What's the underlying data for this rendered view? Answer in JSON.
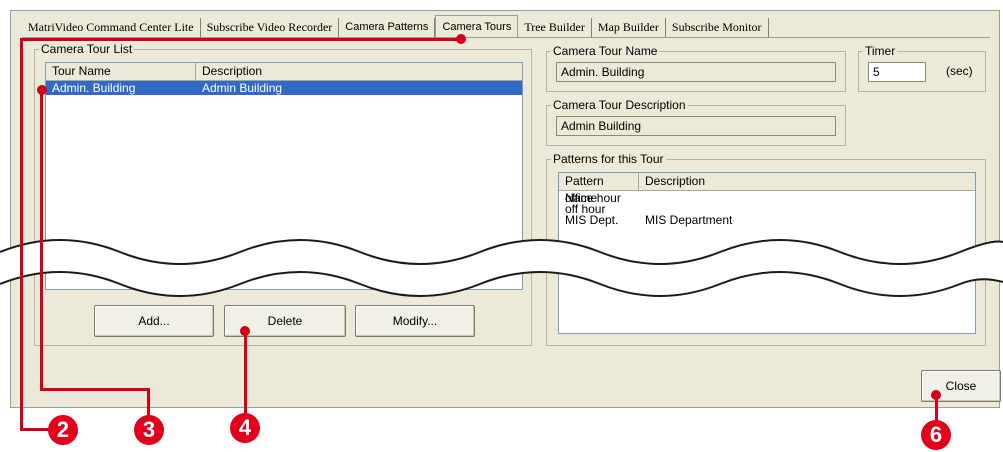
{
  "tabs": [
    {
      "label": "MatriVideo Command Center Lite"
    },
    {
      "label": "Subscribe Video Recorder"
    },
    {
      "label": "Camera Patterns"
    },
    {
      "label": "Camera Tours"
    },
    {
      "label": "Tree Builder"
    },
    {
      "label": "Map Builder"
    },
    {
      "label": "Subscribe Monitor"
    }
  ],
  "active_tab": "Camera Tours",
  "tour_list": {
    "legend": "Camera Tour List",
    "headers": [
      "Tour Name",
      "Description"
    ],
    "rows": [
      {
        "name": "Admin. Building",
        "description": "Admin Building",
        "selected": true
      }
    ]
  },
  "tour_name": {
    "legend": "Camera Tour Name",
    "value": "Admin. Building"
  },
  "timer": {
    "legend": "Timer",
    "value": "5",
    "unit": "(sec)"
  },
  "tour_description": {
    "legend": "Camera Tour Description",
    "value": "Admin Building"
  },
  "patterns": {
    "legend": "Patterns for this Tour",
    "headers": [
      "Pattern Name",
      "Description"
    ],
    "rows": [
      {
        "name": "office hour",
        "description": ""
      },
      {
        "name": "off hour",
        "description": ""
      },
      {
        "name": "MIS Dept.",
        "description": "MIS Department"
      }
    ]
  },
  "buttons": {
    "add": "Add...",
    "delete": "Delete",
    "modify": "Modify...",
    "close": "Close"
  },
  "markers": [
    "2",
    "3",
    "4",
    "6"
  ],
  "colors": {
    "selection": "#316ac5",
    "marker": "#e3001b",
    "window_bg": "#ece9d8"
  }
}
